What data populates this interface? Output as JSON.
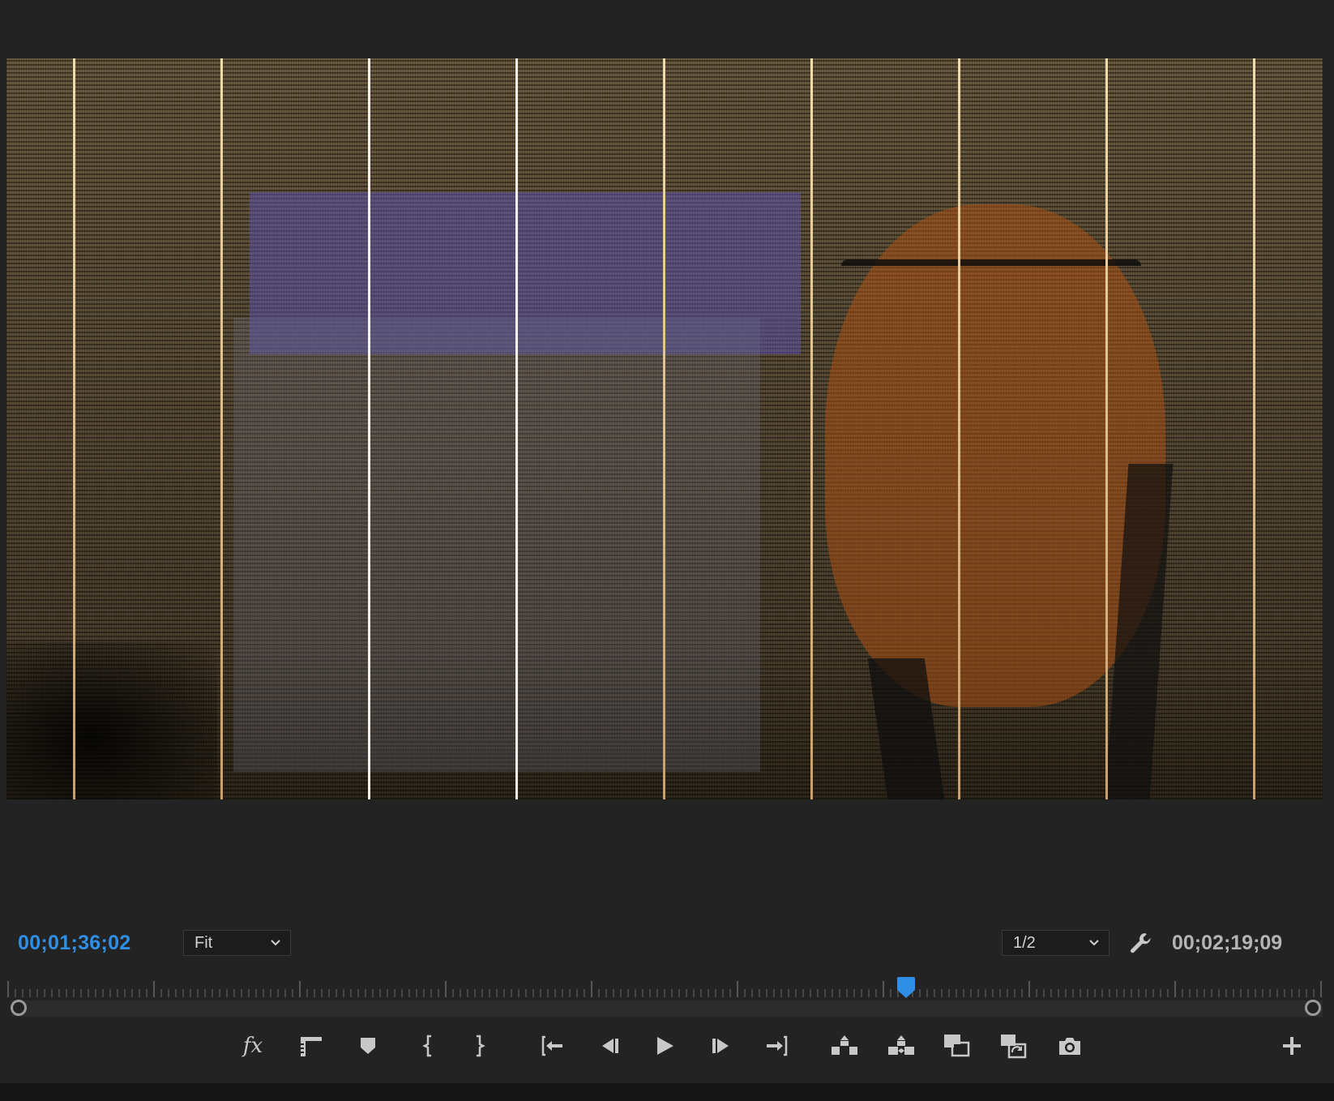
{
  "panel": {
    "current_timecode": "00;01;36;02",
    "duration_timecode": "00;02;19;09",
    "zoom_level": "Fit",
    "resolution": "1/2",
    "playhead_position": 0.683
  },
  "transport": {
    "buttons": [
      {
        "name": "fx-button",
        "icon": "fx-icon",
        "label": "fx"
      },
      {
        "name": "safe-margins-button",
        "icon": "safe-margins-icon"
      },
      {
        "name": "add-marker-button",
        "icon": "marker-icon"
      },
      {
        "name": "mark-in-button",
        "icon": "mark-in-icon"
      },
      {
        "name": "mark-out-button",
        "icon": "mark-out-icon"
      },
      {
        "name": "go-to-in-button",
        "icon": "go-to-in-icon"
      },
      {
        "name": "step-back-button",
        "icon": "step-back-icon"
      },
      {
        "name": "play-button",
        "icon": "play-icon"
      },
      {
        "name": "step-forward-button",
        "icon": "step-forward-icon"
      },
      {
        "name": "go-to-out-button",
        "icon": "go-to-out-icon"
      },
      {
        "name": "lift-button",
        "icon": "lift-icon"
      },
      {
        "name": "extract-button",
        "icon": "extract-icon"
      },
      {
        "name": "comparison-view-button",
        "icon": "comparison-view-icon"
      },
      {
        "name": "toggle-proxies-button",
        "icon": "toggle-proxies-icon"
      },
      {
        "name": "export-frame-button",
        "icon": "camera-icon"
      },
      {
        "name": "button-editor-button",
        "icon": "plus-icon"
      }
    ]
  },
  "colors": {
    "accent": "#2f8ee6",
    "panel_bg": "#232323",
    "icon": "#c8c8c8"
  }
}
